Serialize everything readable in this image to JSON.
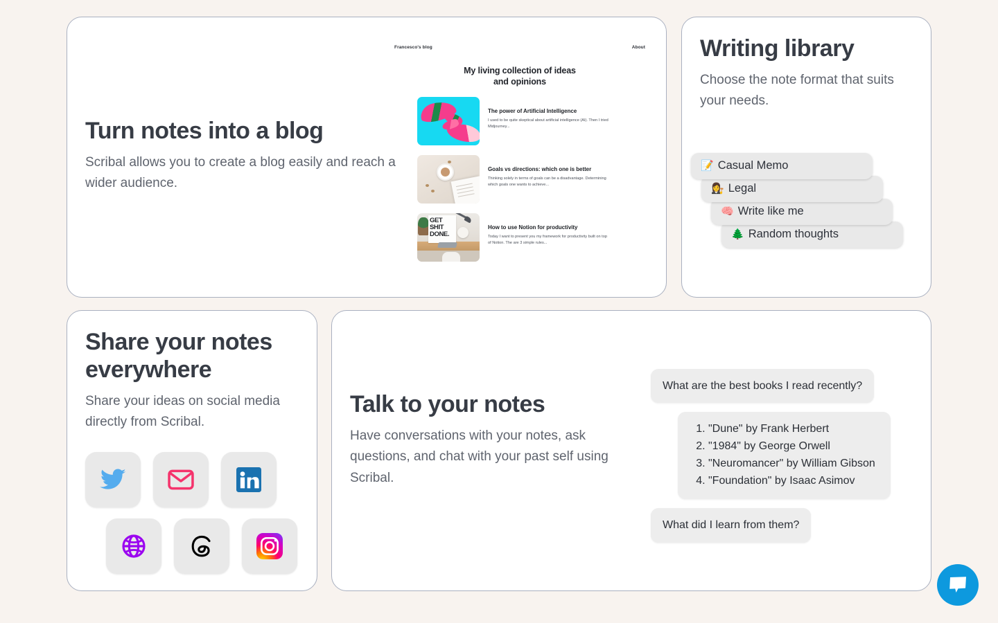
{
  "theme": {
    "page_background": "#f8f3ef",
    "card_background": "#ffffff",
    "card_border": "#a9b0c0",
    "heading_color": "#373c45",
    "body_color": "#5f646e",
    "pill_background": "#e9e9e9",
    "bubble_background": "#ededed",
    "launcher_color": "#0d99de"
  },
  "cards": {
    "blog": {
      "title": "Turn notes into a blog",
      "subtitle": "Scribal allows you to create a blog easily and reach a wider audience.",
      "preview": {
        "site_name": "Francesco's blog",
        "nav_link": "About",
        "headline_line1": "My living collection of ideas",
        "headline_line2": "and opinions",
        "posts": [
          {
            "title": "The power of Artificial Intelligence",
            "excerpt": "I used to be quite skeptical about artificial intelligence (AI). Then I tried Midjourney...",
            "thumbnail": "ai-hands-thumbnail"
          },
          {
            "title": "Goals vs directions: which one is better",
            "excerpt": "Thinking solely in terms of goals can be a disadvantage. Determining which goals one wants to achieve...",
            "thumbnail": "desk-coffee-thumbnail"
          },
          {
            "title": "How to use Notion for productivity",
            "excerpt": "Today I want to present you my framework for productivity built on top of Notion. The are 3 simple rules...",
            "thumbnail": "get-shit-done-desk-thumbnail"
          }
        ]
      }
    },
    "library": {
      "title": "Writing library",
      "subtitle": "Choose the note format that suits your needs.",
      "formats": [
        {
          "emoji": "📝",
          "label": "Casual Memo",
          "icon_name": "memo-emoji"
        },
        {
          "emoji": "👩‍⚖️",
          "label": "Legal",
          "icon_name": "judge-emoji"
        },
        {
          "emoji": "🧠",
          "label": "Write like me",
          "icon_name": "brain-emoji"
        },
        {
          "emoji": "🌲",
          "label": "Random thoughts",
          "icon_name": "evergreen-tree-emoji"
        }
      ]
    },
    "share": {
      "title": "Share your notes everywhere",
      "subtitle": "Share your ideas on social media directly from Scribal.",
      "channels_row1": [
        {
          "icon_name": "twitter-icon",
          "label": "Twitter",
          "color": "#55acee"
        },
        {
          "icon_name": "email-icon",
          "label": "Email",
          "color": "#f5336c"
        },
        {
          "icon_name": "linkedin-icon",
          "label": "LinkedIn",
          "color": "#1a72b0"
        }
      ],
      "channels_row2": [
        {
          "icon_name": "globe-icon",
          "label": "Web",
          "color": "#9b05f0"
        },
        {
          "icon_name": "threads-icon",
          "label": "Threads",
          "color": "#000000"
        },
        {
          "icon_name": "instagram-icon",
          "label": "Instagram",
          "color": "#d6249f"
        }
      ]
    },
    "talk": {
      "title": "Talk to your notes",
      "subtitle": "Have conversations with your notes, ask questions, and chat with your past self using Scribal.",
      "conversation": {
        "question_1": "What are the best books I read recently?",
        "answer_1": [
          "\"Dune\" by Frank Herbert",
          "\"1984\" by George Orwell",
          "\"Neuromancer\" by William Gibson",
          "\"Foundation\" by Isaac Asimov"
        ],
        "question_2": "What did I learn from them?"
      }
    }
  },
  "chat_launcher": {
    "icon_name": "chat-bubble-icon",
    "label": "Open chat"
  }
}
